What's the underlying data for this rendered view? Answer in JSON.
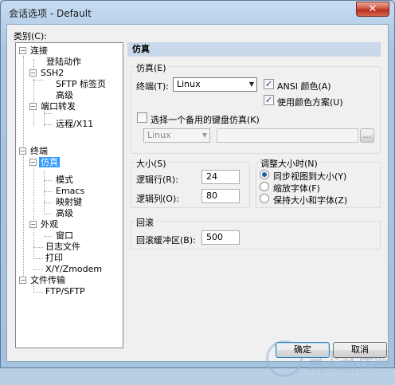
{
  "window": {
    "title": "会话选项 - Default",
    "close_glyph": "✕"
  },
  "category_label": "类别(C):",
  "tree": {
    "items": [
      {
        "label": "连接",
        "expander": "−"
      },
      {
        "label": "登陆动作"
      },
      {
        "label": "SSH2",
        "expander": "−"
      },
      {
        "label": "SFTP 标签页"
      },
      {
        "label": "高级"
      },
      {
        "label": "端口转发",
        "expander": "−"
      },
      {
        "label": "远程/X11"
      },
      {
        "label": "终端",
        "expander": "−"
      },
      {
        "label": "仿真",
        "expander": "−"
      },
      {
        "label": "模式"
      },
      {
        "label": "Emacs"
      },
      {
        "label": "映射键"
      },
      {
        "label": "高级"
      },
      {
        "label": "外观",
        "expander": "−"
      },
      {
        "label": "窗口"
      },
      {
        "label": "日志文件"
      },
      {
        "label": "打印"
      },
      {
        "label": "X/Y/Zmodem"
      },
      {
        "label": "文件传输",
        "expander": "−"
      },
      {
        "label": "FTP/SFTP"
      }
    ],
    "selected_index": 8
  },
  "panel": {
    "header": "仿真",
    "emulation": {
      "group_title": "仿真(E)",
      "terminal_label": "终端(T):",
      "terminal_value": "Linux",
      "ansi_color_label": "ANSI 颜色(A)",
      "ansi_color_checked": true,
      "use_color_scheme_label": "使用颜色方案(U)",
      "use_color_scheme_checked": true,
      "alt_keyboard_label": "选择一个备用的键盘仿真(K)",
      "alt_keyboard_checked": false,
      "alt_keyboard_value": "Linux",
      "browse_label": "..."
    },
    "size": {
      "group_title": "大小(S)",
      "rows_label": "逻辑行(R):",
      "rows_value": "24",
      "cols_label": "逻辑列(O):",
      "cols_value": "80"
    },
    "resize": {
      "group_title": "调整大小时(N)",
      "options": [
        {
          "label": "同步视图到大小(Y)",
          "selected": true
        },
        {
          "label": "缩放字体(F)",
          "selected": false
        },
        {
          "label": "保持大小和字体(Z)",
          "selected": false
        }
      ]
    },
    "scrollback": {
      "group_title": "回滚",
      "buffer_label": "回滚缓冲区(B):",
      "buffer_value": "500"
    }
  },
  "buttons": {
    "ok": "确定",
    "cancel": "取消"
  },
  "watermark": {
    "text": "当下软件园",
    "url": "www.downxia.com"
  }
}
